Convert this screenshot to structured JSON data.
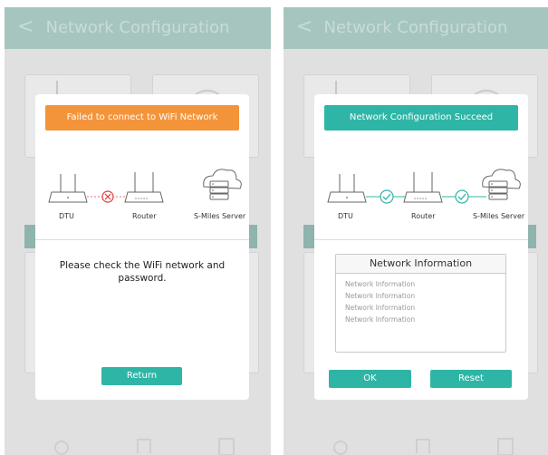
{
  "header": {
    "title": "Network Configuration",
    "back_glyph": "<"
  },
  "left_dialog": {
    "banner": "Failed to connect to WiFi Network",
    "labels": {
      "dtu": "DTU",
      "router": "Router",
      "server": "S-Miles Server"
    },
    "link_status": "error-icon",
    "message": "Please check the WiFi network and password.",
    "return_label": "Return"
  },
  "right_dialog": {
    "banner": "Network Configuration Succeed",
    "labels": {
      "dtu": "DTU",
      "router": "Router",
      "server": "S-Miles Server"
    },
    "link_status": "check-icon",
    "info_title": "Network Information",
    "info_items": [
      "Network Information",
      "Network Information",
      "Network Information",
      "Network Information"
    ],
    "ok_label": "OK",
    "reset_label": "Reset"
  },
  "colors": {
    "fail": "#f4943a",
    "success": "#2fb5a6",
    "header": "#a6c5bf"
  }
}
